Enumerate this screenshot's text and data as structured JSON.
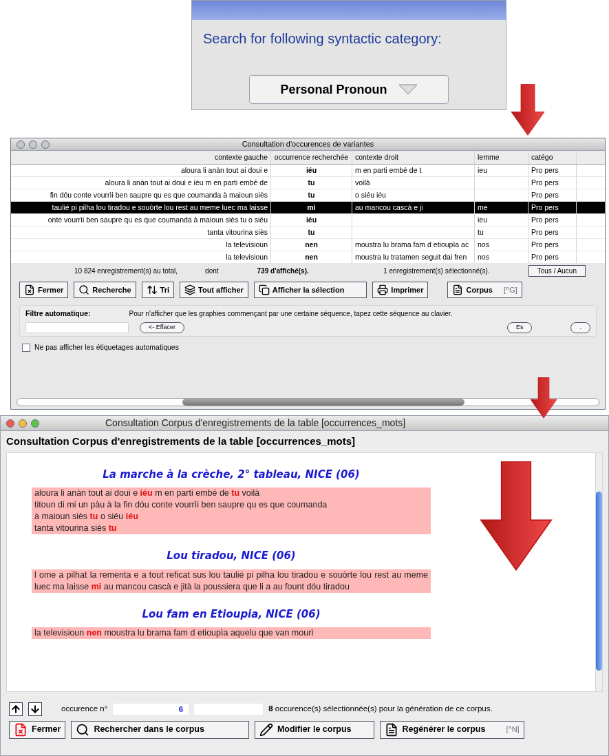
{
  "search_panel": {
    "label": "Search for following syntactic category:",
    "dropdown": "Personal Pronoun"
  },
  "occurrences_window": {
    "title": "Consultation d'occurences de variantes",
    "columns": [
      "contexte gauche",
      "occurrence recherchée",
      "contexte droit",
      "lemme",
      "catégo"
    ],
    "rows": [
      {
        "cells": [
          "aloura li anàn tout ai doui e",
          "iéu",
          "m en parti embé de t",
          "ieu",
          "Pro pers"
        ],
        "selected": false
      },
      {
        "cells": [
          "aloura li anàn tout ai doui e iéu m en parti embé de",
          "tu",
          "voilà",
          "",
          "Pro pers"
        ],
        "selected": false
      },
      {
        "cells": [
          "fin dóu conte vourrìi ben saupre qu es que coumanda à maioun siès",
          "tu",
          "o siéu iéu",
          "",
          "Pro pers"
        ],
        "selected": false
      },
      {
        "cells": [
          "taulié pi pilha lou tiradou e souòrte lou rest au meme luec ma laisse",
          "mi",
          "au mancou cascà e ji",
          "me",
          "Pro pers"
        ],
        "selected": true
      },
      {
        "cells": [
          "onte vourrìi ben saupre qu es que coumanda à maioun siès tu o siéu",
          "iéu",
          "",
          "ieu",
          "Pro pers"
        ],
        "selected": false
      },
      {
        "cells": [
          "tanta vitourina siès",
          "tu",
          "",
          "tu",
          "Pro pers"
        ],
        "selected": false
      },
      {
        "cells": [
          "la televisioun",
          "nen",
          "moustra lu brama fam d etioupìa ac",
          "nos",
          "Pro pers"
        ],
        "selected": false
      },
      {
        "cells": [
          "la televisioun",
          "nen",
          "moustra lu tratamen seguit dai fren",
          "nos",
          "Pro pers"
        ],
        "selected": false
      }
    ],
    "status": {
      "total": "10 824 enregistrement(s) au total,",
      "dont": "dont",
      "displayed": "739 d'affiché(s).",
      "selected_count": "1 enregistrement(s) sélectionné(s).",
      "toggle_button": "Tous / Aucun"
    },
    "buttons": [
      {
        "label": "Fermer"
      },
      {
        "label": "Recherche"
      },
      {
        "label": "Tri"
      },
      {
        "label": "Tout afficher"
      },
      {
        "label": "Afficher la sélection"
      },
      {
        "label": "Imprimer"
      },
      {
        "label": "Corpus",
        "shortcut": "[^G]"
      }
    ],
    "filter": {
      "label": "Filtre automatique:",
      "hint": "Pour n'afficher que les graphies commençant par une certaine séquence, tapez cette séquence au clavier.",
      "clear_button": "<- Effacer",
      "right_buttons": [
        "Es",
        "."
      ]
    },
    "checkbox": {
      "label": "Ne pas afficher les étiquetages automatiques",
      "checked": false
    }
  },
  "corpus_window": {
    "title": "Consultation Corpus d'enregistrements de la table [occurrences_mots]",
    "heading": "Consultation Corpus d'enregistrements de la table [occurrences_mots]",
    "sections": [
      {
        "title": "La marche à la crèche, 2° tableau, NICE (06)",
        "lines": [
          "aloura li anàn tout ai doui e **iéu** m en parti embé de **tu** voilà",
          "titoun di mi un pàu à la fin dóu conte vourrìi ben saupre qu es que coumanda",
          "à maioun siès **tu** o siéu **iéu**",
          "tanta vitourina siès **tu**"
        ]
      },
      {
        "title": "Lou tiradou, NICE (06)",
        "lines": [
          "l ome a pilhat la rementa e a tout reficat sus lou taulié pi pilha lou tiradou e souòrte lou rest au meme luec ma laisse **mi** au mancou cascà e jità la poussiera que li a au fount dóu tiradou"
        ]
      },
      {
        "title": "Lou fam en Etioupia, NICE (06)",
        "lines": [
          "la televisioun **nen** moustra lu brama fam d etioupìa aquelu que van mourì"
        ]
      }
    ],
    "nav": {
      "label": "occurence n°",
      "value": "6",
      "summary": "**8** occurence(s) sélectionnée(s) pour la génération de ce corpus."
    },
    "buttons": [
      {
        "label": "Fermer"
      },
      {
        "label": "Rechercher dans le corpus"
      },
      {
        "label": "Modifier le corpus"
      },
      {
        "label": "Regénérer le corpus",
        "shortcut": "[^N]"
      }
    ]
  }
}
